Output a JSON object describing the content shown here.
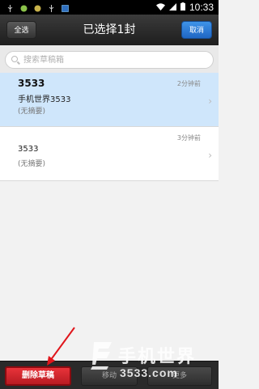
{
  "status_bar": {
    "time": "10:33",
    "icons": [
      "usb-icon",
      "notification-icon",
      "notification-icon",
      "usb-icon",
      "app-icon"
    ],
    "right_icons": [
      "wifi-icon",
      "signal-icon",
      "battery-icon"
    ]
  },
  "header": {
    "select_all_label": "全选",
    "title": "已选择1封",
    "cancel_label": "取消"
  },
  "search": {
    "placeholder": "搜索草稿箱"
  },
  "drafts": [
    {
      "title": "3533",
      "subject": "手机世界3533",
      "summary": "(无摘要)",
      "time": "2分钟前",
      "selected": true
    },
    {
      "title": "",
      "subject": "3533",
      "summary": "(无摘要)",
      "time": "3分钟前",
      "selected": false
    }
  ],
  "bottom_bar": {
    "delete_label": "删除草稿",
    "move_label": "移动",
    "more_label": "更多"
  },
  "watermark": {
    "text_cn": "手机世界",
    "text_num": "3533.com"
  },
  "colors": {
    "selected_row": "#cfe6fb",
    "cancel_button": "#2a7bd8",
    "delete_button": "#d0262d",
    "annotation_arrow": "#e0161c"
  }
}
